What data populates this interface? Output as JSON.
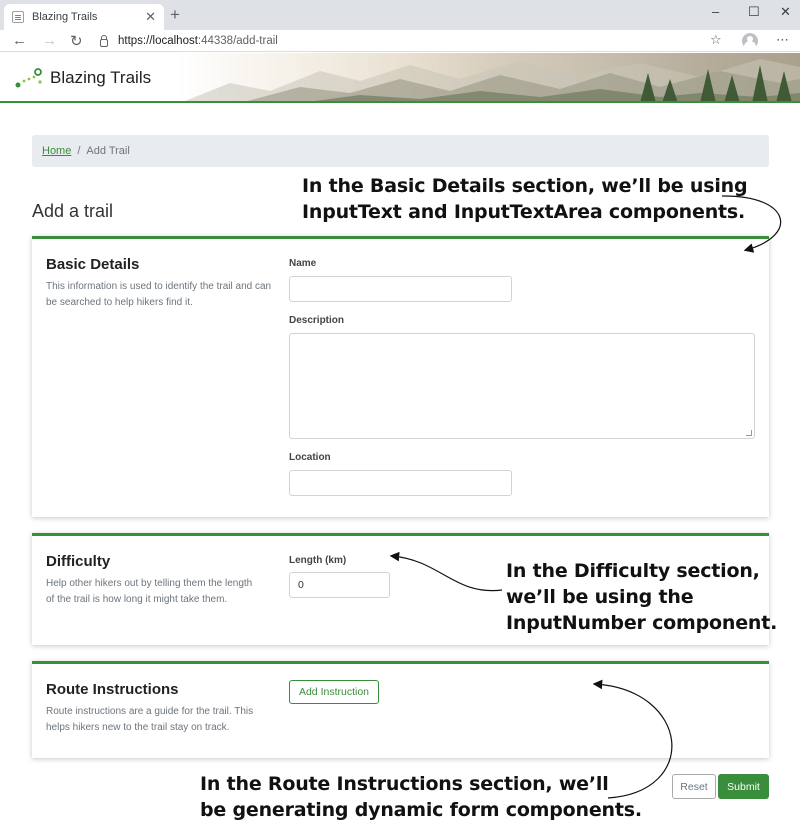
{
  "browser": {
    "tab_title": "Blazing Trails",
    "tab_close": "✕",
    "new_tab": "+",
    "url_host": "https://localhost",
    "url_path": ":44338/add-trail",
    "window_controls": [
      "–",
      "☐",
      "✕"
    ],
    "nav_back": "←",
    "nav_forward": "→",
    "nav_reload": "↻",
    "menu": "⋯"
  },
  "app": {
    "brand": "Blazing Trails",
    "accent": "#3a8d3a"
  },
  "breadcrumb": {
    "home": "Home",
    "separator": "/",
    "current": "Add Trail"
  },
  "page_title": "Add a trail",
  "sections": {
    "basic": {
      "title": "Basic Details",
      "description": "This information is used to identify the trail and can be searched to help hikers find it.",
      "name_label": "Name",
      "name_value": "",
      "description_label": "Description",
      "description_value": "",
      "location_label": "Location",
      "location_value": ""
    },
    "difficulty": {
      "title": "Difficulty",
      "description": "Help other hikers out by telling them the length of the trail is how long it might take them.",
      "length_label": "Length (km)",
      "length_value": "0"
    },
    "route": {
      "title": "Route Instructions",
      "description": "Route instructions are a guide for the trail. This helps hikers new to the trail stay on track.",
      "add_button": "Add Instruction"
    }
  },
  "actions": {
    "reset": "Reset",
    "submit": "Submit"
  },
  "annotations": {
    "basic": [
      "In the Basic Details section, we’ll be using",
      "InputText and InputTextArea components."
    ],
    "difficulty": [
      "In the Difficulty section,",
      "we’ll be using the",
      "InputNumber component."
    ],
    "route": [
      "In the Route Instructions section, we’ll",
      "be generating dynamic form components."
    ]
  }
}
